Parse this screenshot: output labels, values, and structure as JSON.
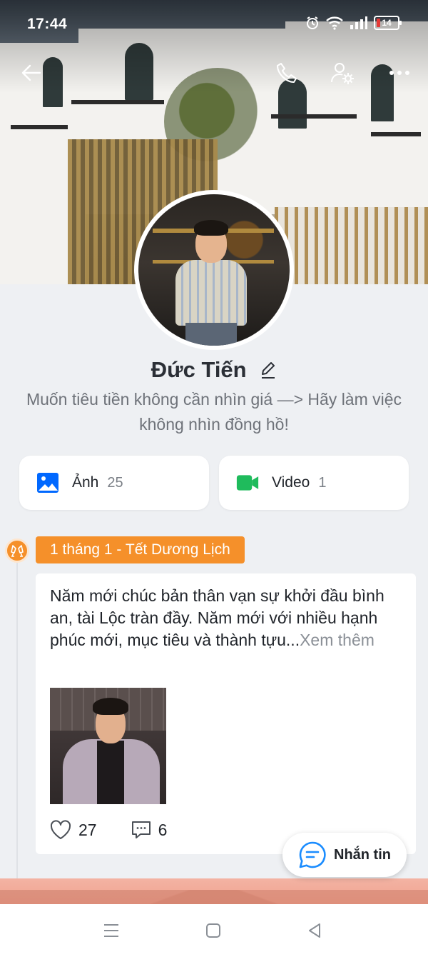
{
  "status_bar": {
    "time": "17:44",
    "battery": "14"
  },
  "profile": {
    "name": "Đức Tiến",
    "bio": "Muốn tiêu tiền không cần nhìn giá —> Hãy làm việc không nhìn đồng hồ!"
  },
  "media": {
    "photos": {
      "label": "Ảnh",
      "count": "25"
    },
    "videos": {
      "label": "Video",
      "count": "1"
    }
  },
  "timeline": {
    "event_tag": "1 tháng 1 - Tết Dương Lịch",
    "post": {
      "text": "Năm mới chúc bản thân vạn sự khởi đầu bình an, tài Lộc tràn đầy. Năm mới với nhiều hạnh phúc mới, mục tiêu và thành tựu...",
      "more_label": "Xem thêm",
      "likes": "27",
      "comments": "6"
    }
  },
  "message_button": {
    "label": "Nhắn tin"
  },
  "colors": {
    "accent_orange": "#f5902a",
    "brand_blue": "#0068ff",
    "video_green": "#1fbb5c"
  }
}
